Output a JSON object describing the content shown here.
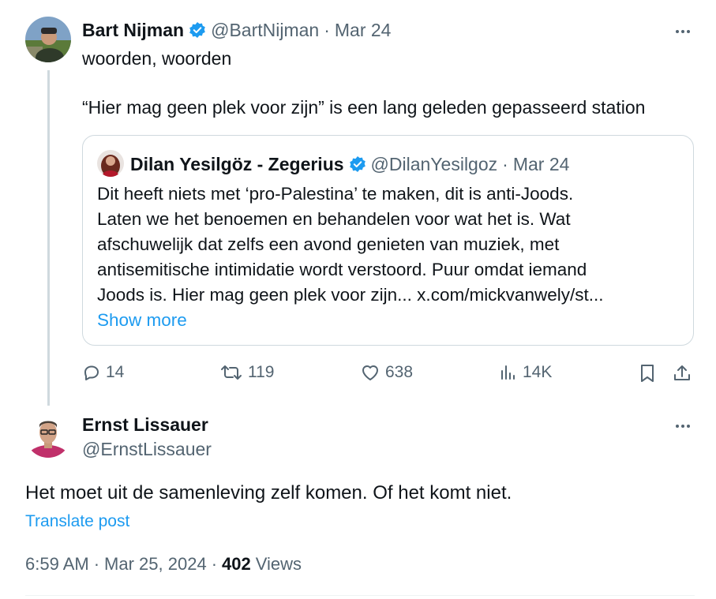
{
  "parent_tweet": {
    "author_name": "Bart Nijman",
    "handle": "@BartNijman",
    "separator": "·",
    "date": "Mar 24",
    "line1": "woorden, woorden",
    "line2": "“Hier mag geen plek voor zijn” is een lang geleden gepasseerd station",
    "quote": {
      "author_name": "Dilan Yesilgöz - Zegerius",
      "handle": "@DilanYesilgoz",
      "separator": "·",
      "date": "Mar 24",
      "lines": [
        "Dit heeft niets met ‘pro-Palestina’ te maken, dit is anti-Joods.",
        "Laten we het benoemen en behandelen voor wat het is. Wat",
        "afschuwelijk dat zelfs een avond genieten van muziek, met",
        "antisemitische intimidatie wordt verstoord. Puur omdat iemand",
        "Joods is. Hier mag geen plek voor zijn... x.com/mickvanwely/st..."
      ],
      "show_more": "Show more"
    },
    "actions": {
      "replies": "14",
      "retweets": "119",
      "likes": "638",
      "views": "14K"
    }
  },
  "main_tweet": {
    "author_name": "Ernst Lissauer",
    "handle": "@ErnstLissauer",
    "text": "Het moet uit de samenleving zelf komen. Of het komt niet.",
    "translate": "Translate post",
    "time": "6:59 AM",
    "separator": "·",
    "date": "Mar 25, 2024",
    "separator2": "·",
    "views_count": "402",
    "views_label": "Views"
  },
  "icons": {
    "verified": "verified-badge-icon",
    "more": "more-dots-icon",
    "reply": "reply-icon",
    "retweet": "retweet-icon",
    "like": "heart-icon",
    "views": "views-bar-icon",
    "bookmark": "bookmark-icon",
    "share": "share-icon"
  },
  "colors": {
    "text": "#0f1419",
    "secondary": "#536471",
    "accent": "#1d9bf0",
    "border": "#cfd9de"
  }
}
